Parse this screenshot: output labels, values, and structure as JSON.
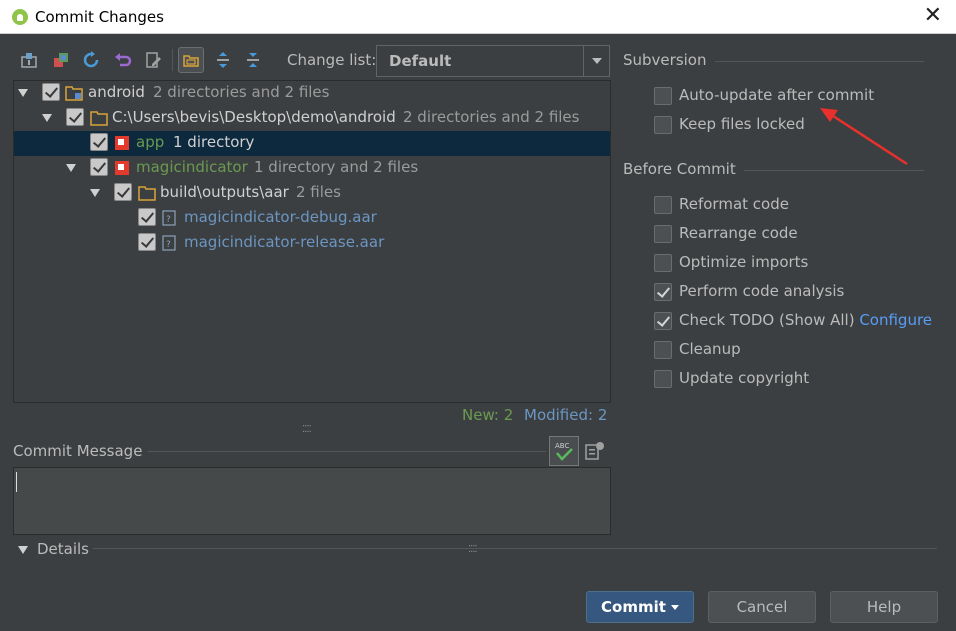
{
  "window": {
    "title": "Commit Changes"
  },
  "toolbar": {
    "changelist_label": "Change list:",
    "changelist_value": "Default"
  },
  "tree": [
    {
      "label": "android",
      "meta": "2 directories and 2 files"
    },
    {
      "label": "C:\\Users\\bevis\\Desktop\\demo\\android",
      "meta": "2 directories and 2 files"
    },
    {
      "label": "app",
      "meta": "1 directory"
    },
    {
      "label": "magicindicator",
      "meta": "1 directory and 2 files"
    },
    {
      "label": "build\\outputs\\aar",
      "meta": "2 files"
    },
    {
      "label": "magicindicator-debug.aar",
      "meta": ""
    },
    {
      "label": "magicindicator-release.aar",
      "meta": ""
    }
  ],
  "status": {
    "new": "New: 2",
    "modified": "Modified: 2"
  },
  "commit_message": {
    "label": "Commit Message",
    "value": ""
  },
  "details": {
    "label": "Details"
  },
  "subversion": {
    "title": "Subversion",
    "options": [
      {
        "label": "Auto-update after commit",
        "checked": false
      },
      {
        "label": "Keep files locked",
        "checked": false
      }
    ]
  },
  "before_commit": {
    "title": "Before Commit",
    "options": [
      {
        "label": "Reformat code",
        "checked": false
      },
      {
        "label": "Rearrange code",
        "checked": false
      },
      {
        "label": "Optimize imports",
        "checked": false
      },
      {
        "label": "Perform code analysis",
        "checked": true
      },
      {
        "label": "Check TODO (Show All)",
        "checked": true,
        "link": "Configure"
      },
      {
        "label": "Cleanup",
        "checked": false
      },
      {
        "label": "Update copyright",
        "checked": false
      }
    ]
  },
  "buttons": {
    "commit": "Commit",
    "cancel": "Cancel",
    "help": "Help"
  },
  "colors": {
    "background": "#3c3f41",
    "selection": "#0d293e",
    "new_green": "#6a9a51",
    "modified_blue": "#6b96c2",
    "link": "#589df6",
    "annotation_red": "#e8302c",
    "primary_button": "#365880"
  }
}
